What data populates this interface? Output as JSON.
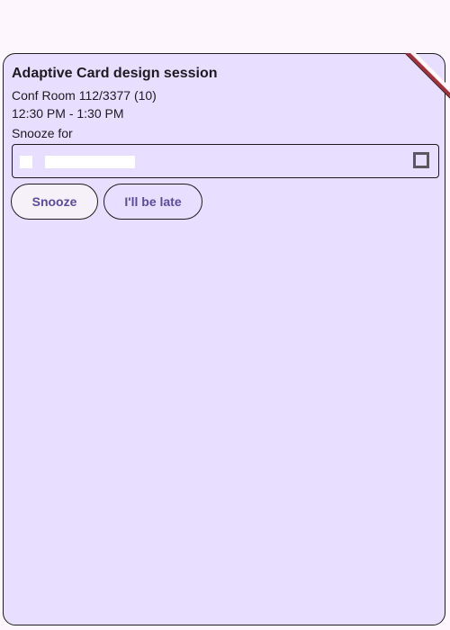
{
  "card": {
    "title": "Adaptive Card design session",
    "room": "Conf Room 112/3377 (10)",
    "time": "12:30 PM - 1:30 PM",
    "snooze_label": "Snooze for",
    "select_value": ""
  },
  "actions": {
    "snooze_label": "Snooze",
    "late_label": "I'll be late"
  },
  "colors": {
    "card_background": "#e8deff",
    "page_background": "#fdf7fd",
    "button_text": "#5e4a9c",
    "ribbon": "#a3333a"
  }
}
